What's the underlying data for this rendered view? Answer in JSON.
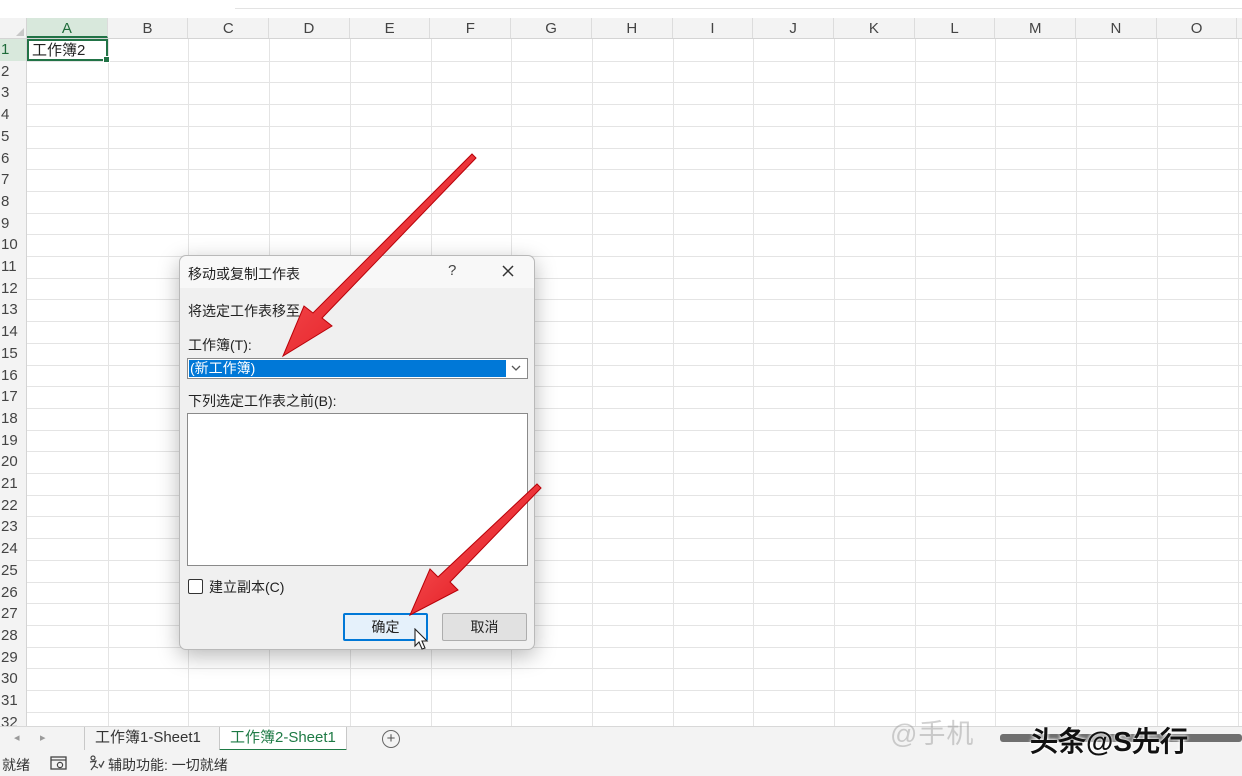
{
  "spreadsheet": {
    "columns": [
      "A",
      "B",
      "C",
      "D",
      "E",
      "F",
      "G",
      "H",
      "I",
      "J",
      "K",
      "L",
      "M",
      "N",
      "O"
    ],
    "rows": [
      "1",
      "2",
      "3",
      "4",
      "5",
      "6",
      "7",
      "8",
      "9",
      "10",
      "11",
      "12",
      "13",
      "14",
      "15",
      "16",
      "17",
      "18",
      "19",
      "20",
      "21",
      "22",
      "23",
      "24",
      "25",
      "26",
      "27",
      "28",
      "29",
      "30",
      "31",
      "32"
    ],
    "active_cell": "A1",
    "a1_value": "工作簿2"
  },
  "tabs": {
    "nav_prev": "◂",
    "nav_next": "▸",
    "items": [
      {
        "label": "工作簿1-Sheet1",
        "active": false
      },
      {
        "label": "工作簿2-Sheet1",
        "active": true
      }
    ],
    "add_label": "+"
  },
  "status": {
    "ready": "就绪",
    "accessibility": "辅助功能: 一切就绪"
  },
  "dialog": {
    "title": "移动或复制工作表",
    "help": "?",
    "instruction": "将选定工作表移至",
    "workbook_label": "工作簿(T):",
    "workbook_value": "(新工作簿)",
    "before_sheet_label": "下列选定工作表之前(B):",
    "create_copy_label": "建立副本(C)",
    "create_copy_checked": false,
    "ok_label": "确定",
    "cancel_label": "取消"
  },
  "watermark": {
    "faint": "@手机",
    "main": "头条@S先行"
  },
  "colors": {
    "excel_green": "#217346",
    "selection_blue": "#0078d7",
    "arrow_red": "#e8141b"
  }
}
